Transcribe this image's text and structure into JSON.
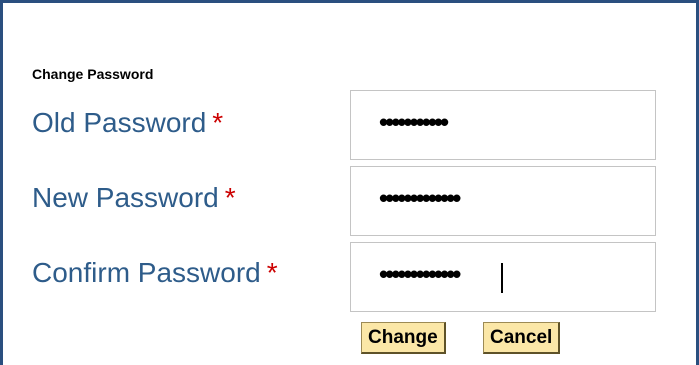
{
  "section_title": "Change Password",
  "fields": [
    {
      "label": "Old Password",
      "required_marker": "*",
      "value_masked": "•••••••••••"
    },
    {
      "label": "New Password",
      "required_marker": "*",
      "value_masked": "•••••••••••••"
    },
    {
      "label": "Confirm Password",
      "required_marker": "*",
      "value_masked": "•••••••••••••"
    }
  ],
  "buttons": {
    "change_label": "Change",
    "cancel_label": "Cancel"
  },
  "colors": {
    "frame_border": "#2a4f7f",
    "label_text": "#2e5c8a",
    "required_marker": "#cc0000",
    "button_bg": "#fbe7a7"
  }
}
